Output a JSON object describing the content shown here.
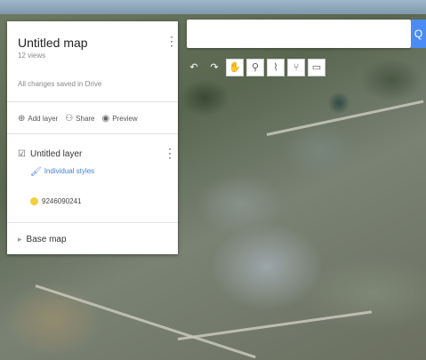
{
  "panel": {
    "title": "Untitled map",
    "views": "12 views",
    "saved_status": "All changes saved in Drive",
    "actions": [
      {
        "icon": "add-layer-icon",
        "label": "Add layer"
      },
      {
        "icon": "share-icon",
        "label": "Share"
      },
      {
        "icon": "preview-icon",
        "label": "Preview"
      }
    ],
    "layer": {
      "name": "Untitled layer",
      "styles_link": "Individual styles",
      "point_label": "9246090241"
    },
    "base_map_label": "Base map"
  },
  "search": {
    "placeholder": "",
    "button_glyph": "Q"
  },
  "toolbar": {
    "tools": [
      {
        "name": "undo-icon",
        "glyph": "↶"
      },
      {
        "name": "redo-icon",
        "glyph": "↷"
      },
      {
        "name": "hand-icon",
        "glyph": "✋"
      },
      {
        "name": "marker-icon",
        "glyph": "⚲"
      },
      {
        "name": "draw-line-icon",
        "glyph": "⌇"
      },
      {
        "name": "directions-icon",
        "glyph": "⑂"
      },
      {
        "name": "ruler-icon",
        "glyph": "▭"
      }
    ]
  },
  "colors": {
    "accent": "#4a8bf5",
    "point": "#f3d03b",
    "link": "#4a7fd6"
  }
}
